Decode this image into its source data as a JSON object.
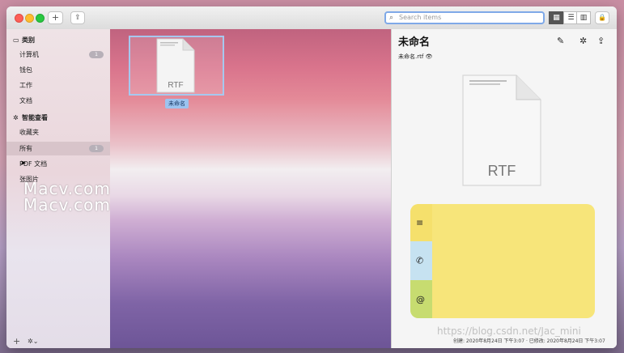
{
  "titlebar": {
    "add_label": "+",
    "share_label": "⇪",
    "search": {
      "placeholder": "Search items",
      "icon": "search-icon"
    },
    "view_grid": "▦",
    "view_list": "☰",
    "view_column": "▥",
    "lock_label": "🔒"
  },
  "sidebar": {
    "section1": {
      "label": "类别",
      "icon": "monitor-icon"
    },
    "items1": [
      {
        "label": "计算机",
        "count": "1"
      },
      {
        "label": "钱包"
      },
      {
        "label": "工作"
      },
      {
        "label": "文档"
      }
    ],
    "section2": {
      "label": "智能查看",
      "icon": "gear-icon"
    },
    "items2": [
      {
        "label": "收藏夹"
      },
      {
        "label": "所有",
        "count": "1"
      },
      {
        "label": "PDF 文档"
      },
      {
        "label": "张图片"
      }
    ],
    "footer_add": "+",
    "footer_settings": "✲⌄"
  },
  "watermark": [
    "Macv.com",
    "Macv.com"
  ],
  "main": {
    "thumbnail": {
      "type_label": "RTF",
      "name": "未命名"
    }
  },
  "inspector": {
    "title": "未命名",
    "filename": "未命名.rtf",
    "doc_type": "RTF",
    "card_tabs": [
      "notes-icon",
      "phone-icon",
      "at-icon"
    ],
    "card_icons": [
      "≡",
      "✆",
      "@"
    ],
    "colors": {
      "card": "#f7e57a",
      "tab_notes": "#f5e06c",
      "tab_phone": "#c6e2f1",
      "tab_at": "#c7dc70"
    }
  },
  "status": {
    "text": "创建: 2020年8月24日 下午3:07 · 已修改: 2020年8月24日 下午3:07"
  },
  "credit": "https://blog.csdn.net/Jac_mini"
}
